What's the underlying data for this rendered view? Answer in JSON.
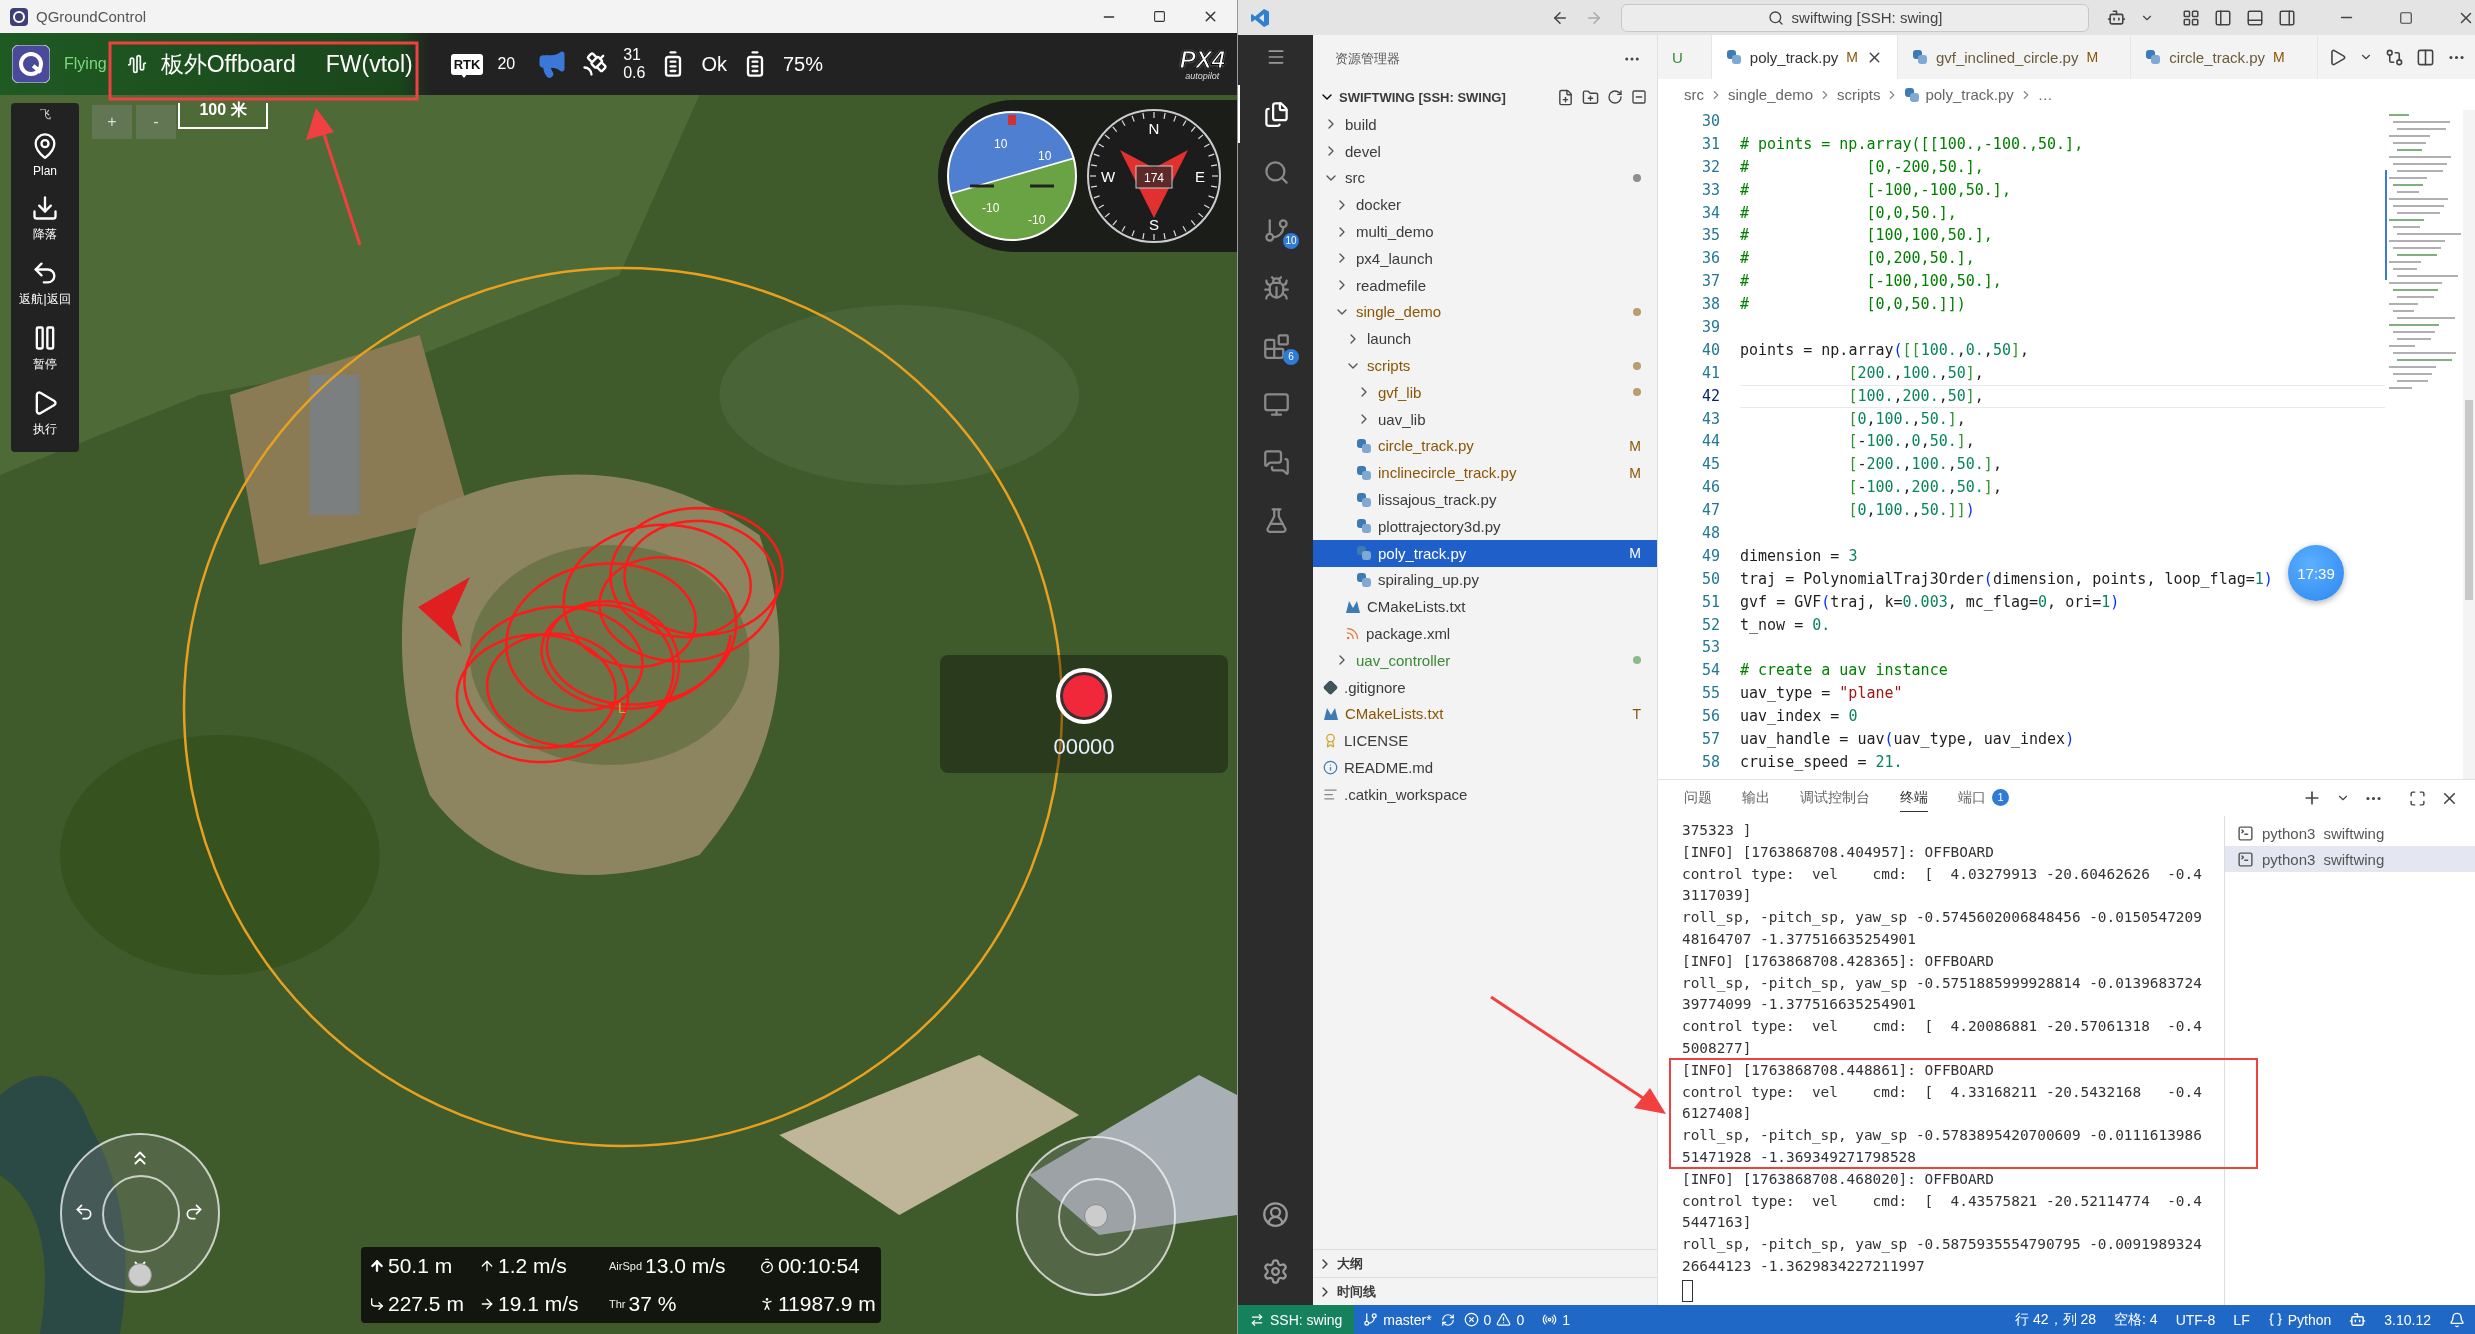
{
  "qgc": {
    "window": {
      "title": "QGroundControl"
    },
    "toolbar": {
      "flight_state": "Flying",
      "flight_mode": "板外Offboard",
      "vehicle_type": "FW(vtol)",
      "rtk": {
        "label": "RTK",
        "count": "20"
      },
      "gps": {
        "count": "31",
        "hdop": "0.6"
      },
      "battery_status": "Ok",
      "battery_percent": "75%",
      "logo": {
        "mark": "PX4",
        "tagline": "autopilot"
      }
    },
    "fly_tools": {
      "title": "飞",
      "items": [
        {
          "kind": "plan",
          "label": "Plan"
        },
        {
          "kind": "land",
          "label": "降落"
        },
        {
          "kind": "rtl",
          "label": "返航|返回"
        },
        {
          "kind": "pause",
          "label": "暂停"
        },
        {
          "kind": "execute",
          "label": "执行"
        }
      ]
    },
    "map": {
      "zoom_in": "+",
      "zoom_out": "-",
      "scale": "100 米",
      "marker_label": "L"
    },
    "attitude": {
      "pitch_labels": [
        "10",
        "10",
        "-10",
        "-10"
      ]
    },
    "compass": {
      "north": "N",
      "east": "E",
      "south": "S",
      "west": "W",
      "heading": "174"
    },
    "recorder": {
      "counter": "00000"
    },
    "telemetry": [
      {
        "kind": "altitude",
        "value": "50.1 m"
      },
      {
        "kind": "climb",
        "value": "1.2 m/s"
      },
      {
        "kind": "airspeed",
        "label": "AirSpd",
        "value": "13.0 m/s"
      },
      {
        "kind": "flight_time",
        "value": "00:10:54"
      },
      {
        "kind": "distance",
        "value": "227.5 m"
      },
      {
        "kind": "ground_speed",
        "value": "19.1 m/s"
      },
      {
        "kind": "throttle",
        "label": "Thr",
        "value": "37 %"
      },
      {
        "kind": "odometer",
        "value": "11987.9 m"
      }
    ]
  },
  "vscode": {
    "title_bar": {
      "search": "swiftwing [SSH: swing]"
    },
    "activity_bar": [
      {
        "kind": "explorer",
        "selected": true
      },
      {
        "kind": "search",
        "selected": false
      },
      {
        "kind": "source_control",
        "selected": false,
        "badge": "10"
      },
      {
        "kind": "run_debug",
        "selected": false
      },
      {
        "kind": "extensions",
        "selected": false,
        "badge": "6"
      },
      {
        "kind": "remote",
        "selected": false
      },
      {
        "kind": "chat",
        "selected": false
      },
      {
        "kind": "testing",
        "selected": false
      }
    ],
    "explorer": {
      "title": "资源管理器",
      "workspace": "SWIFTWING [SSH: SWING]",
      "expanded": true,
      "tree": [
        {
          "name": "build",
          "kind": "folder",
          "expanded": false,
          "selected": false,
          "color": "#3b3b3b"
        },
        {
          "name": "devel",
          "kind": "folder",
          "expanded": false,
          "selected": false,
          "color": "#3b3b3b"
        },
        {
          "name": "src",
          "kind": "folder",
          "expanded": true,
          "selected": false,
          "color": "#3b3b3b",
          "dot": true,
          "children": [
            {
              "name": "docker",
              "kind": "folder",
              "expanded": false,
              "selected": false,
              "color": "#3b3b3b"
            },
            {
              "name": "multi_demo",
              "kind": "folder",
              "expanded": false,
              "selected": false,
              "color": "#3b3b3b"
            },
            {
              "name": "px4_launch",
              "kind": "folder",
              "expanded": false,
              "selected": false,
              "color": "#3b3b3b"
            },
            {
              "name": "readmefile",
              "kind": "folder",
              "expanded": false,
              "selected": false,
              "color": "#3b3b3b"
            },
            {
              "name": "single_demo",
              "kind": "folder",
              "expanded": true,
              "selected": false,
              "color": "#895503",
              "dot": true,
              "children": [
                {
                  "name": "launch",
                  "kind": "folder",
                  "expanded": false,
                  "selected": false,
                  "color": "#3b3b3b"
                },
                {
                  "name": "scripts",
                  "kind": "folder",
                  "expanded": true,
                  "selected": false,
                  "color": "#895503",
                  "dot": true,
                  "children": [
                    {
                      "name": "gvf_lib",
                      "kind": "folder",
                      "expanded": false,
                      "selected": false,
                      "color": "#895503",
                      "dot": true
                    },
                    {
                      "name": "uav_lib",
                      "kind": "folder",
                      "expanded": false,
                      "selected": false,
                      "color": "#3b3b3b"
                    },
                    {
                      "name": "circle_track.py",
                      "kind": "python",
                      "selected": false,
                      "color": "#895503",
                      "badge": "M"
                    },
                    {
                      "name": "inclinecircle_track.py",
                      "kind": "python",
                      "selected": false,
                      "color": "#895503",
                      "badge": "M"
                    },
                    {
                      "name": "lissajous_track.py",
                      "kind": "python",
                      "selected": false,
                      "color": "#3b3b3b"
                    },
                    {
                      "name": "plottrajectory3d.py",
                      "kind": "python",
                      "selected": false,
                      "color": "#3b3b3b"
                    },
                    {
                      "name": "poly_track.py",
                      "kind": "python",
                      "selected": true,
                      "badge": "M"
                    },
                    {
                      "name": "spiraling_up.py",
                      "kind": "python",
                      "selected": false,
                      "color": "#3b3b3b"
                    }
                  ]
                },
                {
                  "name": "CMakeLists.txt",
                  "kind": "cmake",
                  "selected": false,
                  "color": "#3b3b3b"
                },
                {
                  "name": "package.xml",
                  "kind": "xml",
                  "selected": false,
                  "color": "#3b3b3b"
                }
              ]
            },
            {
              "name": "uav_controller",
              "kind": "folder",
              "expanded": false,
              "selected": false,
              "color": "#388a34",
              "dot": true
            }
          ]
        },
        {
          "name": ".gitignore",
          "kind": "git",
          "selected": false,
          "color": "#3b3b3b"
        },
        {
          "name": "CMakeLists.txt",
          "kind": "cmake",
          "selected": false,
          "color": "#895503",
          "badge": "T"
        },
        {
          "name": "LICENSE",
          "kind": "license",
          "selected": false,
          "color": "#3b3b3b"
        },
        {
          "name": "README.md",
          "kind": "info",
          "selected": false,
          "color": "#3b3b3b"
        },
        {
          "name": ".catkin_workspace",
          "kind": "text",
          "selected": false,
          "color": "#3b3b3b"
        }
      ],
      "sections": [
        {
          "label": "大纲",
          "expanded": false
        },
        {
          "label": "时间线",
          "expanded": false
        }
      ]
    },
    "tabs": [
      {
        "kind": "partial",
        "label": "U",
        "selected": false
      },
      {
        "kind": "file",
        "label": "poly_track.py",
        "badge": "M",
        "selected": true
      },
      {
        "kind": "file",
        "label": "gvf_inclined_circle.py",
        "badge": "M",
        "selected": false
      },
      {
        "kind": "file",
        "label": "circle_track.py",
        "badge": "M",
        "selected": false
      }
    ],
    "breadcrumb": [
      {
        "label": "src",
        "kind": "folder"
      },
      {
        "label": "single_demo",
        "kind": "folder"
      },
      {
        "label": "scripts",
        "kind": "folder"
      },
      {
        "label": "poly_track.py",
        "kind": "file"
      },
      {
        "label": "…",
        "kind": "more"
      }
    ],
    "editor": {
      "floating_clock": "17:39",
      "lines": [
        {
          "num": "30",
          "current": false
        },
        {
          "num": "31",
          "text": "# points = np.array([[100.,-100.,50.],",
          "current": false
        },
        {
          "num": "32",
          "text": "#             [0,-200,50.],",
          "current": false
        },
        {
          "num": "33",
          "text": "#             [-100,-100,50.],",
          "current": false
        },
        {
          "num": "34",
          "text": "#             [0,0,50.],",
          "current": false
        },
        {
          "num": "35",
          "text": "#             [100,100,50.],",
          "current": false
        },
        {
          "num": "36",
          "text": "#             [0,200,50.],",
          "current": false
        },
        {
          "num": "37",
          "text": "#             [-100,100,50.],",
          "current": false
        },
        {
          "num": "38",
          "text": "#             [0,0,50.]])",
          "current": false
        },
        {
          "num": "39",
          "current": false
        },
        {
          "num": "40",
          "text": "points = np.array([[100.,0.,50],",
          "current": false
        },
        {
          "num": "41",
          "text": "            [200.,100.,50],",
          "current": false
        },
        {
          "num": "42",
          "text": "            [100.,200.,50],",
          "current": true
        },
        {
          "num": "43",
          "text": "            [0,100.,50.],",
          "current": false
        },
        {
          "num": "44",
          "text": "            [-100.,0,50.],",
          "current": false
        },
        {
          "num": "45",
          "text": "            [-200.,100.,50.],",
          "current": false
        },
        {
          "num": "46",
          "text": "            [-100.,200.,50.],",
          "current": false
        },
        {
          "num": "47",
          "text": "            [0,100.,50.]])",
          "current": false
        },
        {
          "num": "48",
          "current": false
        },
        {
          "num": "49",
          "text": "dimension = 3",
          "current": false
        },
        {
          "num": "50",
          "text": "traj = PolynomialTraj3Order(dimension, points, loop_flag=1)",
          "current": false
        },
        {
          "num": "51",
          "text": "gvf = GVF(traj, k=0.003, mc_flag=0, ori=1)",
          "current": false
        },
        {
          "num": "52",
          "text": "t_now = 0.",
          "current": false
        },
        {
          "num": "53",
          "current": false
        },
        {
          "num": "54",
          "text": "# create a uav instance",
          "current": false
        },
        {
          "num": "55",
          "text": "uav_type = \"plane\"",
          "current": false
        },
        {
          "num": "56",
          "text": "uav_index = 0",
          "current": false
        },
        {
          "num": "57",
          "text": "uav_handle = uav(uav_type, uav_index)",
          "current": false
        },
        {
          "num": "58",
          "text": "cruise_speed = 21.",
          "current": false
        }
      ]
    },
    "panel": {
      "tabs": [
        {
          "label": "问题",
          "selected": false
        },
        {
          "label": "输出",
          "selected": false
        },
        {
          "label": "调试控制台",
          "selected": false
        },
        {
          "label": "终端",
          "selected": true
        },
        {
          "label": "端口",
          "selected": false,
          "badge": "1"
        }
      ],
      "terminal_lines": [
        "375323 ]",
        "[INFO] [1763868708.404957]: OFFBOARD",
        "control type:  vel    cmd:  [  4.03279913 -20.60462626  -0.4",
        "3117039]",
        "roll_sp, -pitch_sp, yaw_sp -0.5745602006848456 -0.0150547209",
        "48164707 -1.377516635254901",
        "[INFO] [1763868708.428365]: OFFBOARD",
        "roll_sp, -pitch_sp, yaw_sp -0.5751885999928814 -0.0139683724",
        "39774099 -1.377516635254901",
        "control type:  vel    cmd:  [  4.20086881 -20.57061318  -0.4",
        "5008277]",
        "[INFO] [1763868708.448861]: OFFBOARD",
        "control type:  vel    cmd:  [  4.33168211 -20.5432168   -0.4",
        "6127408]",
        "roll_sp, -pitch_sp, yaw_sp -0.5783895420700609 -0.0111613986",
        "51471928 -1.369349271798528",
        "[INFO] [1763868708.468020]: OFFBOARD",
        "control type:  vel    cmd:  [  4.43575821 -20.52114774  -0.4",
        "5447163]",
        "roll_sp, -pitch_sp, yaw_sp -0.5875935554790795 -0.0091989324",
        "26644123 -1.3629834227211997"
      ],
      "terminals": [
        {
          "name": "python3",
          "label": "swiftwing",
          "selected": false
        },
        {
          "name": "python3",
          "label": "swiftwing",
          "selected": true
        }
      ]
    },
    "status_bar": {
      "remote": "SSH: swing",
      "branch": "master*",
      "errors": "0",
      "warnings": "0",
      "ports": "1",
      "position": "行 42，列 28",
      "indent": "空格: 4",
      "encoding": "UTF-8",
      "eol": "LF",
      "language": "Python",
      "version": "3.10.12"
    }
  }
}
